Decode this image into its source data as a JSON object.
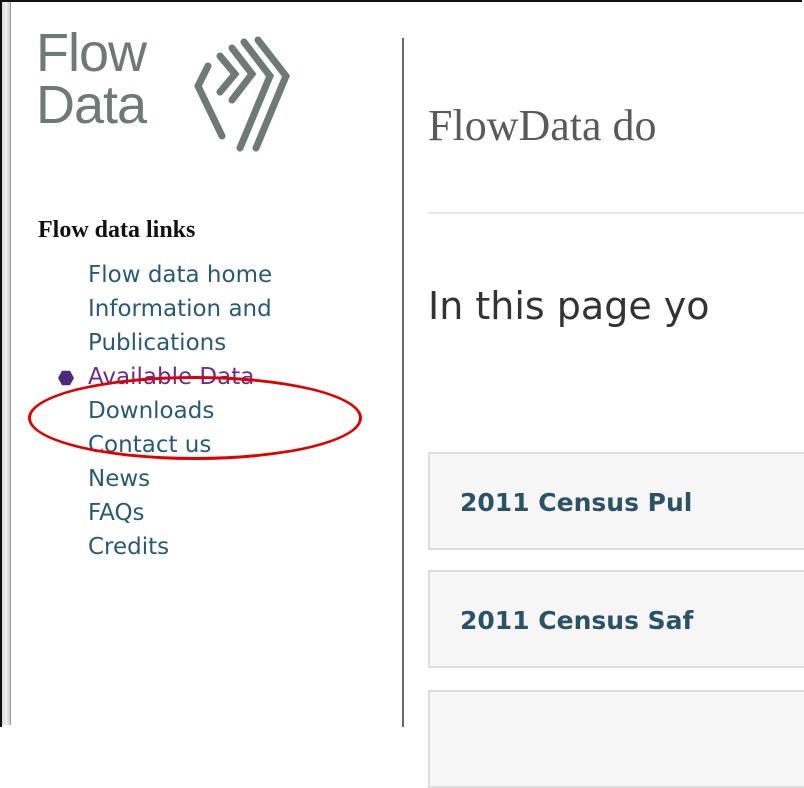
{
  "logo": {
    "line1": "Flow",
    "line2": "Data",
    "icon": "flow-chevrons-icon",
    "color": "#6e7a76"
  },
  "sidebar": {
    "heading": "Flow data links",
    "items": [
      {
        "label": "Flow data home",
        "active": false
      },
      {
        "label": "Information and Publications",
        "active": false
      },
      {
        "label": "Available Data",
        "active": true
      },
      {
        "label": "Downloads",
        "active": false
      },
      {
        "label": "Contact us",
        "active": false
      },
      {
        "label": "News",
        "active": false
      },
      {
        "label": "FAQs",
        "active": false
      },
      {
        "label": "Credits",
        "active": false
      }
    ],
    "link_color": "#2a5a73",
    "active_color": "#6c2a8f",
    "highlight_color": "#e00000"
  },
  "main": {
    "title": "FlowData do",
    "intro": "In this page yo",
    "panels": [
      {
        "label": "2011 Census Pul"
      },
      {
        "label": "2011 Census Saf"
      },
      {
        "label": ""
      }
    ]
  }
}
